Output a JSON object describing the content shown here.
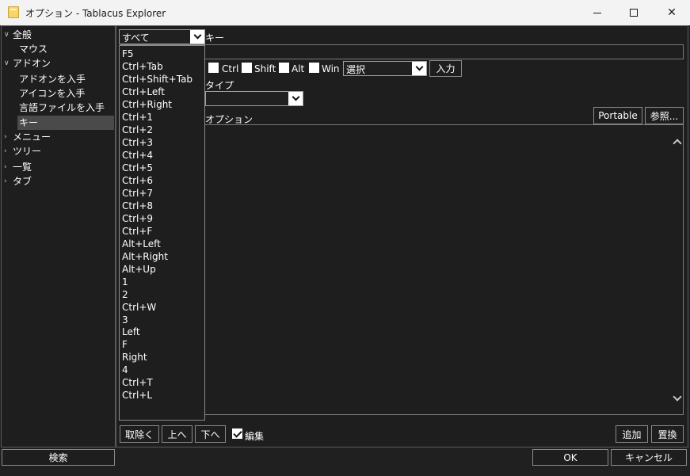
{
  "window": {
    "title": "オプション - Tablacus Explorer"
  },
  "tree": {
    "items": [
      {
        "label": "全般",
        "arrow": "expanded"
      },
      {
        "label": "マウス",
        "arrow": ""
      },
      {
        "label": "アドオン",
        "arrow": "expanded"
      },
      {
        "label": "アドオンを入手",
        "arrow": ""
      },
      {
        "label": "アイコンを入手",
        "arrow": ""
      },
      {
        "label": "言語ファイルを入手",
        "arrow": ""
      },
      {
        "label": "キー",
        "arrow": "",
        "selected": true
      },
      {
        "label": "メニュー",
        "arrow": "collapsed"
      },
      {
        "label": "ツリー",
        "arrow": "collapsed"
      },
      {
        "label": "一覧",
        "arrow": "collapsed"
      },
      {
        "label": "タブ",
        "arrow": "collapsed"
      }
    ]
  },
  "filter_combo": {
    "value": "すべて"
  },
  "key_section": {
    "key_label": "キー",
    "ctrl_label": "Ctrl",
    "shift_label": "Shift",
    "alt_label": "Alt",
    "win_label": "Win",
    "select_value": "選択",
    "input_button": "入力",
    "type_label": "タイプ",
    "option_label": "オプション",
    "portable_button": "Portable",
    "browse_button": "参照..."
  },
  "dropdown": {
    "items": [
      "F5",
      "Ctrl+Tab",
      "Ctrl+Shift+Tab",
      "Ctrl+Left",
      "Ctrl+Right",
      "Ctrl+1",
      "Ctrl+2",
      "Ctrl+3",
      "Ctrl+4",
      "Ctrl+5",
      "Ctrl+6",
      "Ctrl+7",
      "Ctrl+8",
      "Ctrl+9",
      "Ctrl+F",
      "Alt+Left",
      "Alt+Right",
      "Alt+Up",
      "1",
      "2",
      "Ctrl+W",
      "3",
      "Left",
      "F",
      "Right",
      "4",
      "Ctrl+T",
      "Ctrl+L"
    ]
  },
  "list_buttons": {
    "remove": "取除く",
    "up": "上へ",
    "down": "下へ",
    "edit_label": "編集",
    "edit_checked": true,
    "add": "追加",
    "replace": "置換"
  },
  "footer": {
    "search_button": "検索",
    "ok_button": "OK",
    "cancel_button": "キャンセル"
  }
}
